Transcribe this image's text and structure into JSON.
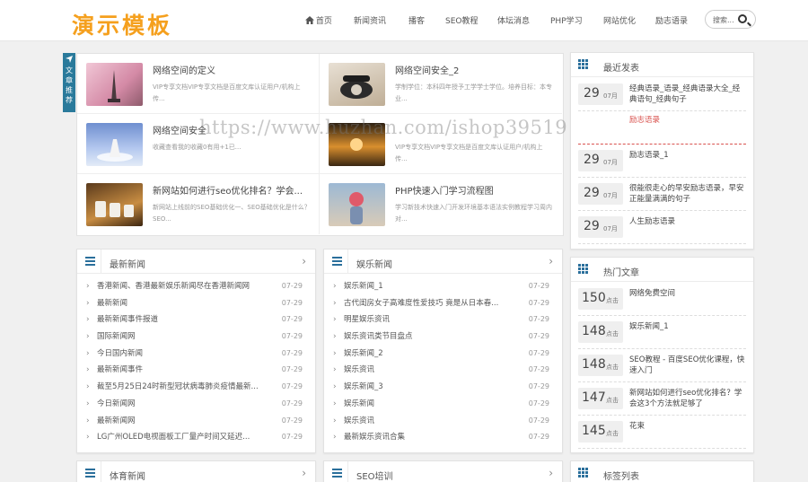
{
  "header": {
    "logo": "演示模板",
    "nav": [
      "首页",
      "新闻资讯",
      "播客",
      "SEO教程",
      "体坛消息",
      "PHP学习",
      "网站优化",
      "励志语录"
    ],
    "search_label": "搜索..."
  },
  "featured": {
    "tag": "文章推荐",
    "items": [
      {
        "title": "网络空间的定义",
        "desc": "VIP专享文档VIP专享文档是百度文库认证用户/机构上传..."
      },
      {
        "title": "网络空间安全_2",
        "desc": "学制学位：本科四年授予工学学士学位。培养目标：本专业..."
      },
      {
        "title": "网络空间安全",
        "desc": "收藏查看我的收藏0有用+1已..."
      },
      {
        "title": "",
        "desc": "VIP专享文档VIP专享文档是百度文库认证用户/机构上传..."
      },
      {
        "title": "新网站如何进行seo优化排名？学会...",
        "desc": "新网站上线前的SEO基础优化一、SEO基础优化是什么？SEO..."
      },
      {
        "title": "PHP快速入门学习流程图",
        "desc": "学习新技术快速入门开发环境基本语法实例教程学习周内对..."
      }
    ]
  },
  "latest_news": {
    "title": "最新新闻",
    "items": [
      {
        "text": "香港新闻、香港最新娱乐新闻尽在香港新闻网",
        "date": "07-29"
      },
      {
        "text": "最新新闻",
        "date": "07-29"
      },
      {
        "text": "最新新闻事件报道",
        "date": "07-29"
      },
      {
        "text": "国际新闻网",
        "date": "07-29"
      },
      {
        "text": "今日国内新闻",
        "date": "07-29"
      },
      {
        "text": "最新新闻事件",
        "date": "07-29"
      },
      {
        "text": "截至5月25日24时新型冠状病毒肺炎疫情最新...",
        "date": "07-29"
      },
      {
        "text": "今日新闻网",
        "date": "07-29"
      },
      {
        "text": "最新新闻网",
        "date": "07-29"
      },
      {
        "text": "LG广州OLED电视面板工厂量产时间又延迟...",
        "date": "07-29"
      }
    ]
  },
  "ent_news": {
    "title": "娱乐新闻",
    "items": [
      {
        "text": "娱乐新闻_1",
        "date": "07-29"
      },
      {
        "text": "古代闺房女子高难度性爱技巧 竟是从日本春...",
        "date": "07-29"
      },
      {
        "text": "明星娱乐资讯",
        "date": "07-29"
      },
      {
        "text": "娱乐资讯类节目盘点",
        "date": "07-29"
      },
      {
        "text": "娱乐新闻_2",
        "date": "07-29"
      },
      {
        "text": "娱乐资讯",
        "date": "07-29"
      },
      {
        "text": "娱乐新闻_3",
        "date": "07-29"
      },
      {
        "text": "娱乐新闻",
        "date": "07-29"
      },
      {
        "text": "娱乐资讯",
        "date": "07-29"
      },
      {
        "text": "最新娱乐资讯合集",
        "date": "07-29"
      }
    ]
  },
  "recent_posts": {
    "title": "最近发表",
    "items": [
      {
        "day": "29",
        "month": "07月",
        "text": "经典语录_语录_经典语录大全_经典语句_经典句子"
      },
      {
        "day": "",
        "month": "",
        "text": "励志语录"
      },
      {
        "day": "29",
        "month": "07月",
        "text": "励志语录_1"
      },
      {
        "day": "29",
        "month": "07月",
        "text": "很能很走心的早安励志语录，早安正能量满满的句子"
      },
      {
        "day": "29",
        "month": "07月",
        "text": "人生励志语录"
      }
    ]
  },
  "hot_posts": {
    "title": "热门文章",
    "items": [
      {
        "count": "150",
        "unit": "点击",
        "text": "网络免费空间"
      },
      {
        "count": "148",
        "unit": "点击",
        "text": "娱乐新闻_1"
      },
      {
        "count": "148",
        "unit": "点击",
        "text": "SEO教程 - 百度SEO优化课程，快速入门"
      },
      {
        "count": "147",
        "unit": "点击",
        "text": "新网站如何进行seo优化排名？学会这3个方法就足够了"
      },
      {
        "count": "145",
        "unit": "点击",
        "text": "花束"
      }
    ]
  },
  "bottom": {
    "sports": "体育新闻",
    "seo": "SEO培训",
    "tags": "标签列表"
  },
  "watermark": "https://www.huzhan.com/ishop39519",
  "colors": {
    "accent": "#2a7a9b",
    "logo": "#f5a01e",
    "red_link": "#d9534f"
  }
}
